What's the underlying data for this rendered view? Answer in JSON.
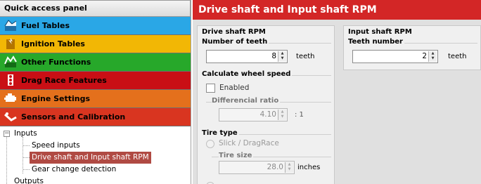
{
  "quick_access": {
    "title": "Quick access panel",
    "categories": [
      {
        "label": "Fuel Tables",
        "color": "#2aa7e6",
        "icon": "fuel-table-icon"
      },
      {
        "label": "Ignition Tables",
        "color": "#f2b705",
        "icon": "ignition-table-icon"
      },
      {
        "label": "Other Functions",
        "color": "#27a82a",
        "icon": "other-functions-icon"
      },
      {
        "label": "Drag Race Features",
        "color": "#c90f15",
        "icon": "drag-race-icon"
      },
      {
        "label": "Engine Settings",
        "color": "#e4701c",
        "icon": "engine-icon"
      },
      {
        "label": "Sensors and Calibration",
        "color": "#d93520",
        "icon": "sensors-icon"
      }
    ],
    "tree": {
      "expander": "−",
      "root": "Inputs",
      "children": [
        "Speed inputs",
        "Drive shaft and Input shaft RPM",
        "Gear change detection"
      ],
      "selected_index": 1,
      "next_root": "Outputs"
    }
  },
  "page": {
    "title": "Drive shaft and Input shaft RPM",
    "title_color": "#d32626"
  },
  "drive_shaft": {
    "title": "Drive shaft RPM",
    "teeth_group": "Number of teeth",
    "teeth_value": "8",
    "teeth_unit": "teeth",
    "wheel_speed_group": "Calculate wheel speed",
    "enabled_label": "Enabled",
    "enabled_checked": false,
    "ratio_group": "Differencial ratio",
    "ratio_value": "4.10",
    "ratio_unit": ": 1",
    "tire_type_group": "Tire type",
    "tire_option": "Slick / DragRace",
    "tire_size_group": "Tire size",
    "tire_size_value": "28.0",
    "tire_size_unit": "inches"
  },
  "input_shaft": {
    "title": "Input shaft RPM",
    "teeth_group": "Teeth number",
    "teeth_value": "2",
    "teeth_unit": "teeth"
  },
  "spin_arrows": {
    "up": "▲",
    "down": "▼"
  }
}
